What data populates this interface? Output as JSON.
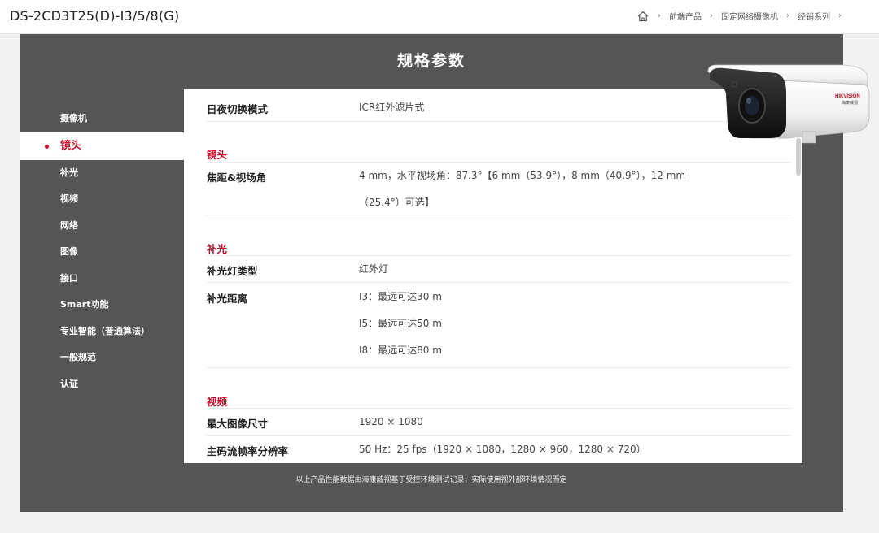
{
  "header": {
    "model": "DS-2CD3T25(D)-I3/5/8(G)",
    "breadcrumb": [
      "前端产品",
      "固定网络摄像机",
      "经销系列"
    ]
  },
  "panel": {
    "title": "规格参数",
    "footnote": "以上产品性能数据由海康威视基于受控环境测试记录，实际使用视外部环境情况而定"
  },
  "sidebar": {
    "items": [
      "摄像机",
      "镜头",
      "补光",
      "视频",
      "网络",
      "图像",
      "接口",
      "Smart功能",
      "专业智能（普通算法）",
      "一般规范",
      "认证"
    ],
    "active": "镜头"
  },
  "specs": {
    "camera": {
      "day_night_label": "日夜切换模式",
      "day_night_value": "ICR红外滤片式"
    },
    "lens": {
      "heading": "镜头",
      "focal_label": "焦距&视场角",
      "focal_value_1": "4 mm，水平视场角：87.3°【6 mm（53.9°），8 mm（40.9°），12 mm",
      "focal_value_2": "（25.4°）可选】"
    },
    "fill_light": {
      "heading": "补光",
      "type_label": "补光灯类型",
      "type_value": "红外灯",
      "distance_label": "补光距离",
      "distance_values": [
        "I3：最远可达30 m",
        "I5：最远可达50 m",
        "I8：最远可达80 m"
      ]
    },
    "video": {
      "heading": "视频",
      "max_res_label": "最大图像尺寸",
      "max_res_value": "1920 × 1080",
      "stream_label": "主码流帧率分辨率",
      "stream_value": "50 Hz：25 fps（1920 × 1080，1280 × 960，1280 × 720）"
    }
  },
  "product_image": {
    "brand_label": "HIKVISION",
    "brand_cn": "海康威视"
  },
  "colors": {
    "accent": "#c8102e",
    "panel": "#555555",
    "page": "#f2f2f2"
  }
}
